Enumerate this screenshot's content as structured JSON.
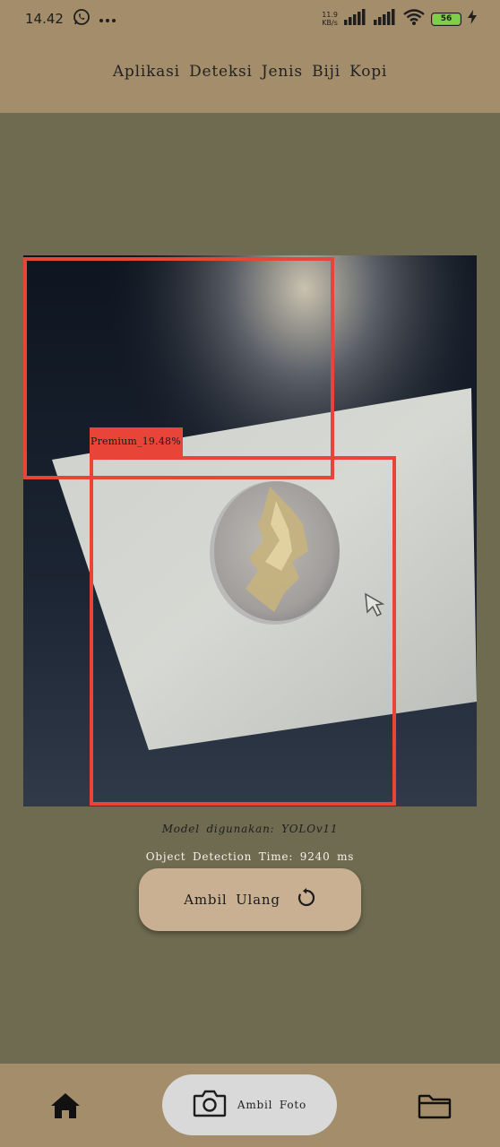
{
  "status_bar": {
    "time": "14.42",
    "net_speed_value": "11.9",
    "net_speed_unit": "KB/s",
    "battery": "56",
    "icons": [
      "whatsapp-icon",
      "more-icon",
      "signal-icon",
      "wifi-icon",
      "battery-icon",
      "charging-icon"
    ]
  },
  "header": {
    "title": "Aplikasi Deteksi Jenis Biji Kopi"
  },
  "detection": {
    "label": "Premium_19.48%",
    "box_color": "#e84438"
  },
  "info": {
    "model_text": "Model digunakan: YOLOv11",
    "time_text": "Object Detection Time: 9240 ms"
  },
  "retake_button": {
    "label": "Ambil Ulang",
    "icon": "refresh-icon"
  },
  "bottom_nav": {
    "home_icon": "home-icon",
    "camera_label": "Ambil Foto",
    "camera_icon": "camera-icon",
    "folder_icon": "folder-icon"
  },
  "colors": {
    "header_bg": "#a38d6a",
    "body_bg": "#6e6b50",
    "button_bg": "#c9b092",
    "nav_active_bg": "#d9d9d9"
  }
}
